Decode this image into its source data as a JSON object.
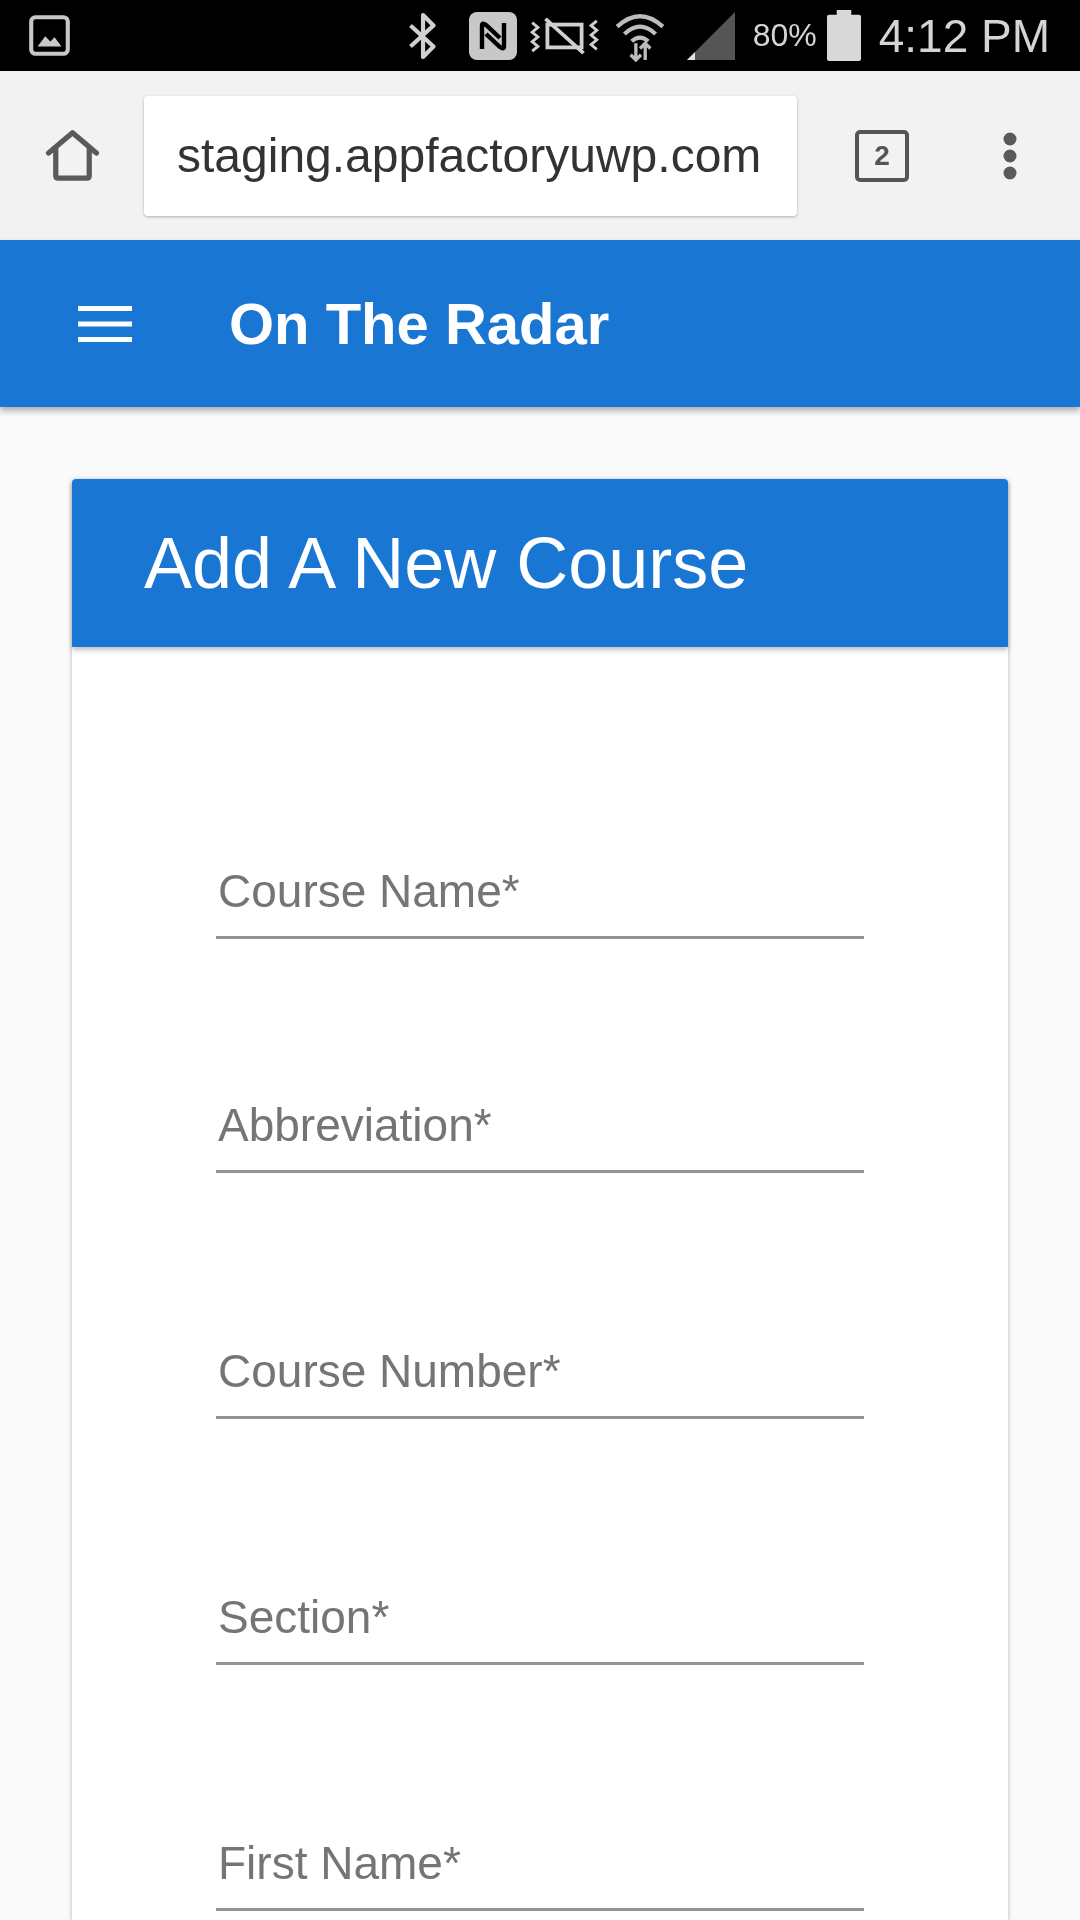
{
  "status_bar": {
    "battery": "80%",
    "time": "4:12 PM"
  },
  "browser": {
    "url": "staging.appfactoryuwp.com",
    "tab_count": "2"
  },
  "app_bar": {
    "title": "On The Radar"
  },
  "form": {
    "title": "Add A New Course",
    "fields": [
      {
        "placeholder": "Course Name*"
      },
      {
        "placeholder": "Abbreviation*"
      },
      {
        "placeholder": "Course Number*"
      },
      {
        "placeholder": "Section*"
      },
      {
        "placeholder": "First Name*"
      }
    ]
  }
}
